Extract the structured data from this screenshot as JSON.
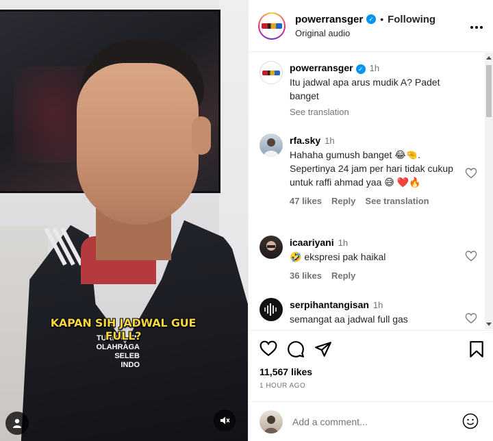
{
  "video": {
    "caption": "KAPAN SIH JADWAL GUE FULL?",
    "jacket_text": "TURNAMEN OLAHRAGA SELEB INDO",
    "user_tag_icon": "person-icon",
    "mute_icon": "muted-speaker-icon"
  },
  "header": {
    "username": "powerransger",
    "following": "Following",
    "separator": "•",
    "audio": "Original audio",
    "more_icon": "more-horizontal-icon"
  },
  "comments": [
    {
      "username": "powerransger",
      "time": "1h",
      "text": "Itu jadwal apa arus mudik A? Padet banget",
      "see_translation": "See translation"
    },
    {
      "username": "rfa.sky",
      "time": "1h",
      "text": "Hahaha gumush banget 😂🤏. Sepertinya 24 jam per hari tidak cukup untuk raffi ahmad yaa 😅 ❤️🔥",
      "likes": "47 likes",
      "reply": "Reply",
      "see_translation": "See translation"
    },
    {
      "username": "icaariyani",
      "time": "1h",
      "text": "🤣 ekspresi pak haikal",
      "likes": "36 likes",
      "reply": "Reply"
    },
    {
      "username": "serpihantangisan",
      "time": "1h",
      "text": "semangat aa jadwal full gas"
    }
  ],
  "actions": {
    "likes": "11,567 likes",
    "time_ago": "1 HOUR AGO"
  },
  "add_comment": {
    "placeholder": "Add a comment..."
  },
  "colors": {
    "accent_blue": "#0095f6",
    "caption_yellow": "#f6d63a",
    "muted_text": "#737373"
  }
}
